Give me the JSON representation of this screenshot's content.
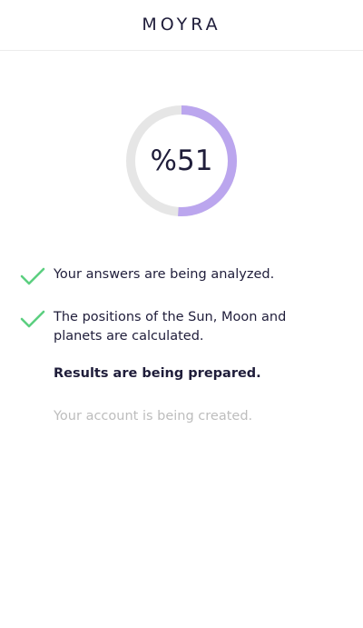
{
  "header": {
    "logo": "MOYRA"
  },
  "progress": {
    "label": "%51",
    "value": 51,
    "track_color": "#e6e6e6",
    "fill_color": "#bba6ee"
  },
  "steps": [
    {
      "label": "Your answers are being analyzed.",
      "status": "done",
      "icon": "check-icon"
    },
    {
      "label": "The positions of the Sun, Moon and planets are calculated.",
      "status": "done",
      "icon": "check-icon"
    },
    {
      "label": "Results are being prepared.",
      "status": "active"
    },
    {
      "label": "Your account is being created.",
      "status": "pending"
    }
  ],
  "colors": {
    "check": "#5ccf80",
    "text": "#1f1d3a",
    "muted": "#bdbdbd"
  }
}
